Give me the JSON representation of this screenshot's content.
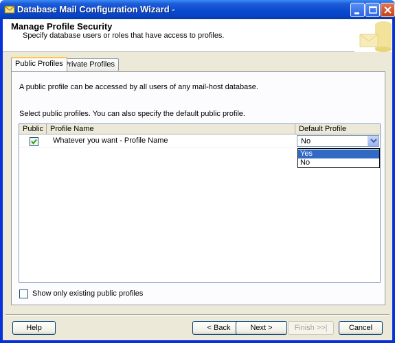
{
  "window": {
    "title": "Database Mail Configuration Wizard -",
    "colors": {
      "titlebar": "#0a4ad0",
      "client": "#ece9d8",
      "selection": "#316ac5"
    }
  },
  "header": {
    "title": "Manage Profile Security",
    "subtitle": "Specify database users or roles that have access to profiles."
  },
  "tabs": [
    {
      "label": "Public Profiles",
      "active": true
    },
    {
      "label": "Private Profiles",
      "active": false
    }
  ],
  "panel": {
    "description": "A public profile can be accessed by all users of any mail-host database.",
    "instruction": "Select public profiles. You can also specify the default public profile."
  },
  "grid": {
    "columns": [
      "Public",
      "Profile Name",
      "Default Profile"
    ],
    "rows": [
      {
        "public": true,
        "profile_name": "Whatever you want - Profile Name",
        "default_profile": "No"
      }
    ],
    "dropdown_options": [
      "Yes",
      "No"
    ],
    "highlighted_option": "Yes"
  },
  "show_only_existing": {
    "label": "Show only existing public profiles",
    "checked": false
  },
  "buttons": {
    "help": "Help",
    "back": "< Back",
    "next": "Next >",
    "finish": "Finish >>|",
    "cancel": "Cancel"
  }
}
